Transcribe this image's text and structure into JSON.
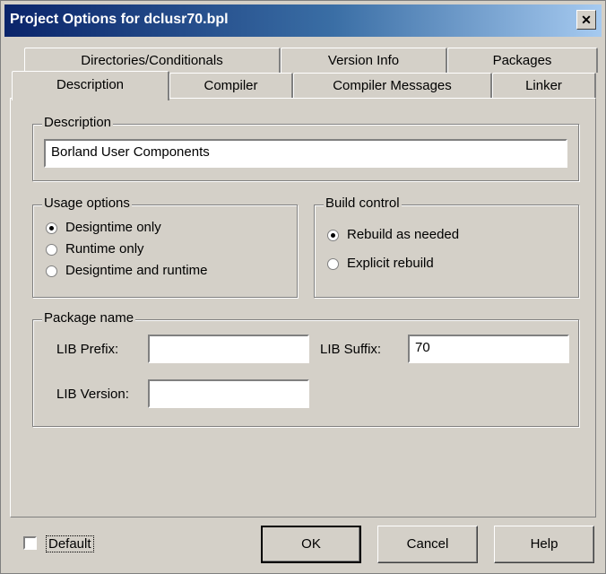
{
  "window": {
    "title": "Project Options for dclusr70.bpl",
    "close_glyph": "✕"
  },
  "tabs": {
    "row1": [
      "Directories/Conditionals",
      "Version Info",
      "Packages"
    ],
    "row2": [
      "Description",
      "Compiler",
      "Compiler Messages",
      "Linker"
    ],
    "active": "Description"
  },
  "description_group": {
    "label": "Description",
    "value": "Borland User Components"
  },
  "usage_options": {
    "label": "Usage options",
    "options": [
      "Designtime only",
      "Runtime only",
      "Designtime and runtime"
    ],
    "selected": "Designtime only"
  },
  "build_control": {
    "label": "Build control",
    "options": [
      "Rebuild as needed",
      "Explicit rebuild"
    ],
    "selected": "Rebuild as needed"
  },
  "package_name": {
    "label": "Package name",
    "lib_prefix_label": "LIB Prefix:",
    "lib_prefix_value": "",
    "lib_suffix_label": "LIB Suffix:",
    "lib_suffix_value": "70",
    "lib_version_label": "LIB Version:",
    "lib_version_value": ""
  },
  "footer": {
    "default_label": "Default",
    "default_checked": false,
    "ok_label": "OK",
    "cancel_label": "Cancel",
    "help_label": "Help"
  }
}
